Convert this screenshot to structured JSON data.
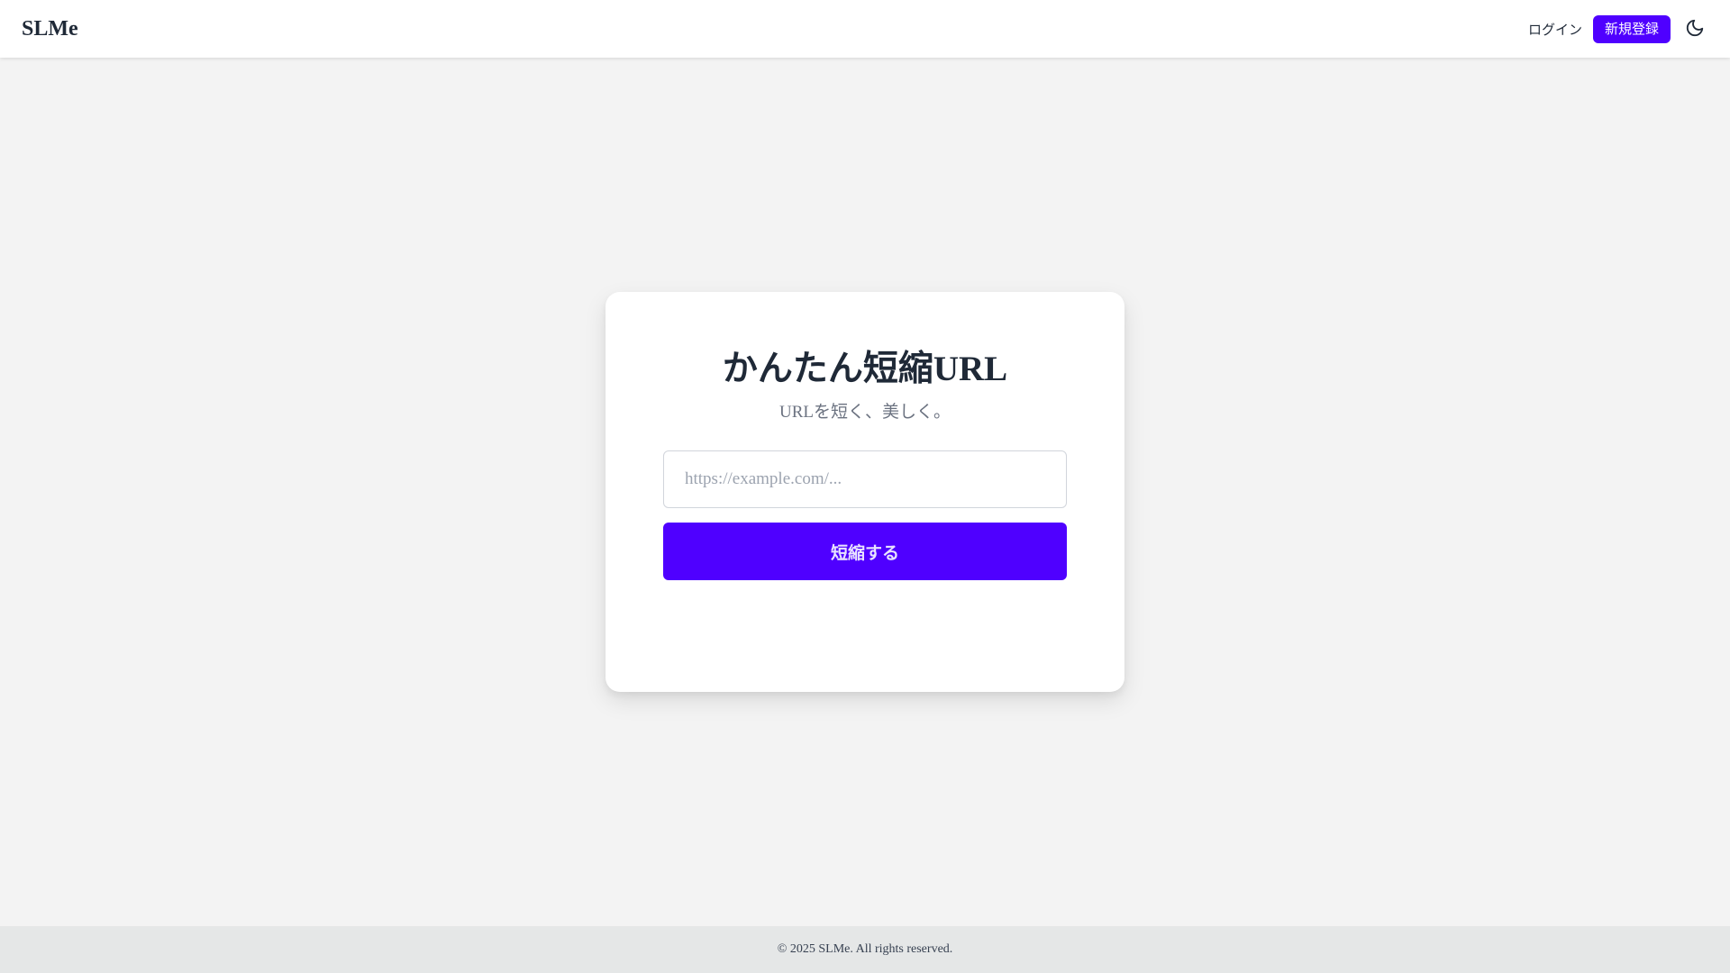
{
  "header": {
    "brand": "SLMe",
    "login_label": "ログイン",
    "signup_label": "新規登録",
    "theme_icon": "moon-icon"
  },
  "hero": {
    "title": "かんたん短縮URL",
    "subtitle": "URLを短く、美しく。",
    "url_input": {
      "value": "",
      "placeholder": "https://example.com/..."
    },
    "submit_label": "短縮する"
  },
  "footer": {
    "copyright": "© 2025 SLMe. All rights reserved."
  },
  "colors": {
    "accent": "#4f00ff",
    "background": "#f3f3f3",
    "card": "#ffffff",
    "footer": "#e5e7e7"
  }
}
